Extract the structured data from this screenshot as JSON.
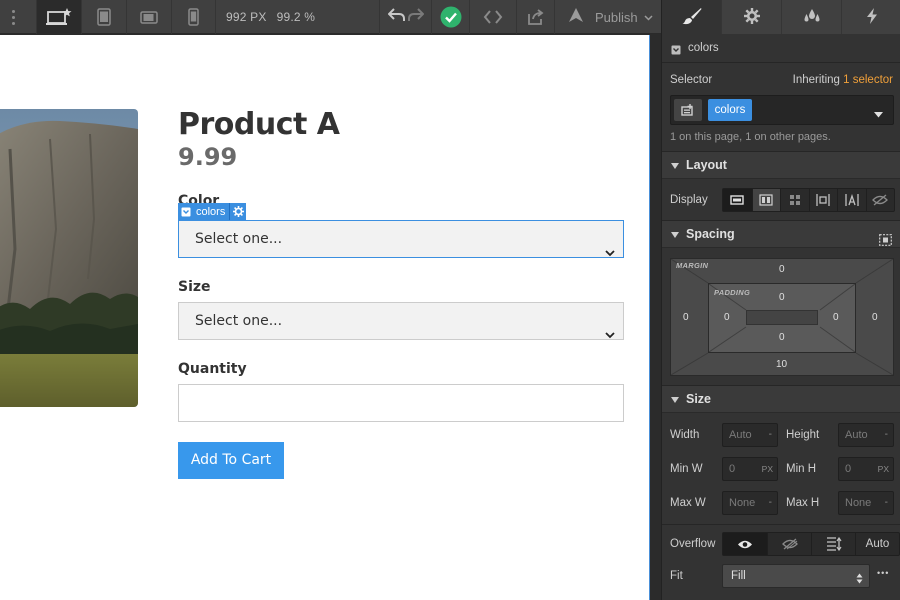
{
  "toolbar": {
    "canvas_width": "992 PX",
    "zoom": "99.2 %",
    "publish_label": "Publish",
    "status_color": "#2fb36d"
  },
  "product": {
    "title": "Product A",
    "price": "9.99",
    "color_label": "Color",
    "color_placeholder": "Select one...",
    "size_label": "Size",
    "size_placeholder": "Select one...",
    "quantity_label": "Quantity",
    "add_to_cart": "Add To Cart"
  },
  "selection_tag": {
    "class_name": "colors"
  },
  "panel": {
    "element_class": "colors",
    "selector_label": "Selector",
    "inheriting_text": "Inheriting",
    "inheriting_count": "1 selector",
    "selector_chip": "colors",
    "usage_text": "1 on this page, 1 on other pages.",
    "layout_title": "Layout",
    "display_label": "Display",
    "spacing_title": "Spacing",
    "margin_label": "MARGIN",
    "padding_label": "PADDING",
    "margin": {
      "top": "0",
      "right": "0",
      "bottom": "10",
      "left": "0"
    },
    "padding": {
      "top": "0",
      "right": "0",
      "bottom": "0",
      "left": "0"
    },
    "size_title": "Size",
    "width_label": "Width",
    "width_value": "Auto",
    "height_label": "Height",
    "height_value": "Auto",
    "min_w_label": "Min W",
    "min_w_value": "0",
    "min_h_label": "Min H",
    "min_h_value": "0",
    "max_w_label": "Max W",
    "max_w_value": "None",
    "max_h_label": "Max H",
    "max_h_value": "None",
    "px_unit": "PX",
    "dash": "-",
    "overflow_label": "Overflow",
    "overflow_auto": "Auto",
    "fit_label": "Fit",
    "fit_value": "Fill",
    "more": "•••"
  },
  "icons": {
    "desktop": "desktop-star-icon",
    "tablet": "tablet-icon",
    "landscape": "mobile-landscape-icon",
    "portrait": "mobile-portrait-icon",
    "undo": "undo-icon",
    "redo": "redo-icon",
    "check": "check-circle-icon",
    "code": "code-icon",
    "export": "export-icon",
    "brush": "brush-icon",
    "gear": "gear-icon",
    "drops": "drops-icon",
    "bolt": "bolt-icon"
  }
}
